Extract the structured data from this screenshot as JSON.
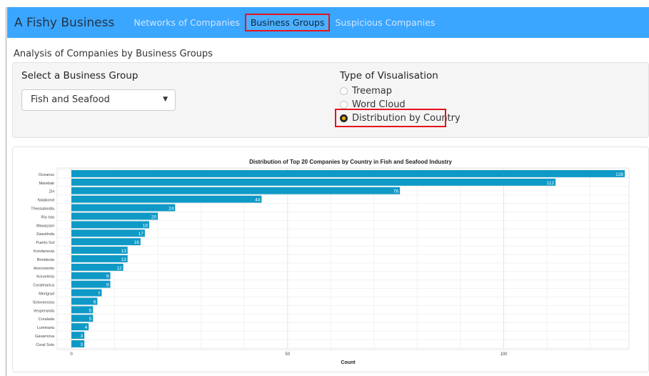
{
  "navbar": {
    "brand": "A Fishy Business",
    "tabs": [
      {
        "label": "Networks of Companies",
        "active": false
      },
      {
        "label": "Business Groups",
        "active": true
      },
      {
        "label": "Suspicious Companies",
        "active": false
      }
    ]
  },
  "page": {
    "subtitle": "Analysis of Companies by Business Groups"
  },
  "controls": {
    "select_label": "Select a Business Group",
    "select_value": "Fish and Seafood",
    "viz_label": "Type of Visualisation",
    "options": [
      {
        "label": "Treemap",
        "checked": false
      },
      {
        "label": "Word Cloud",
        "checked": false
      },
      {
        "label": "Distribution by Country",
        "checked": true
      }
    ]
  },
  "colors": {
    "accent": "#3ba6ff",
    "bar": "#0f99c6",
    "highlight": "#e3141c"
  },
  "chart_data": {
    "type": "bar",
    "orientation": "horizontal",
    "title": "Distribution of Top 20 Companies by Country in Fish and Seafood Industry",
    "xlabel": "Count",
    "ylabel": "",
    "xlim": [
      0,
      128
    ],
    "xticks": [
      0,
      50,
      100
    ],
    "categories": [
      "Oceanus",
      "Marebak",
      "ZH",
      "Nalakond",
      "Thessalandia",
      "Rio Isla",
      "Mawazam",
      "Zawalinda",
      "Puerto Sol",
      "Kondanovia",
      "Brindisola",
      "Arreciviento",
      "Korseleria",
      "Coralmarica",
      "Merigrad",
      "Solovarossa",
      "Vesperanda",
      "Coralada",
      "Luminaria",
      "Gavarnova",
      "Coral Solo"
    ],
    "values": [
      128,
      112,
      76,
      44,
      24,
      20,
      18,
      17,
      16,
      13,
      13,
      12,
      9,
      9,
      7,
      6,
      5,
      5,
      4,
      3,
      3
    ],
    "grid": true,
    "legend": "none"
  }
}
